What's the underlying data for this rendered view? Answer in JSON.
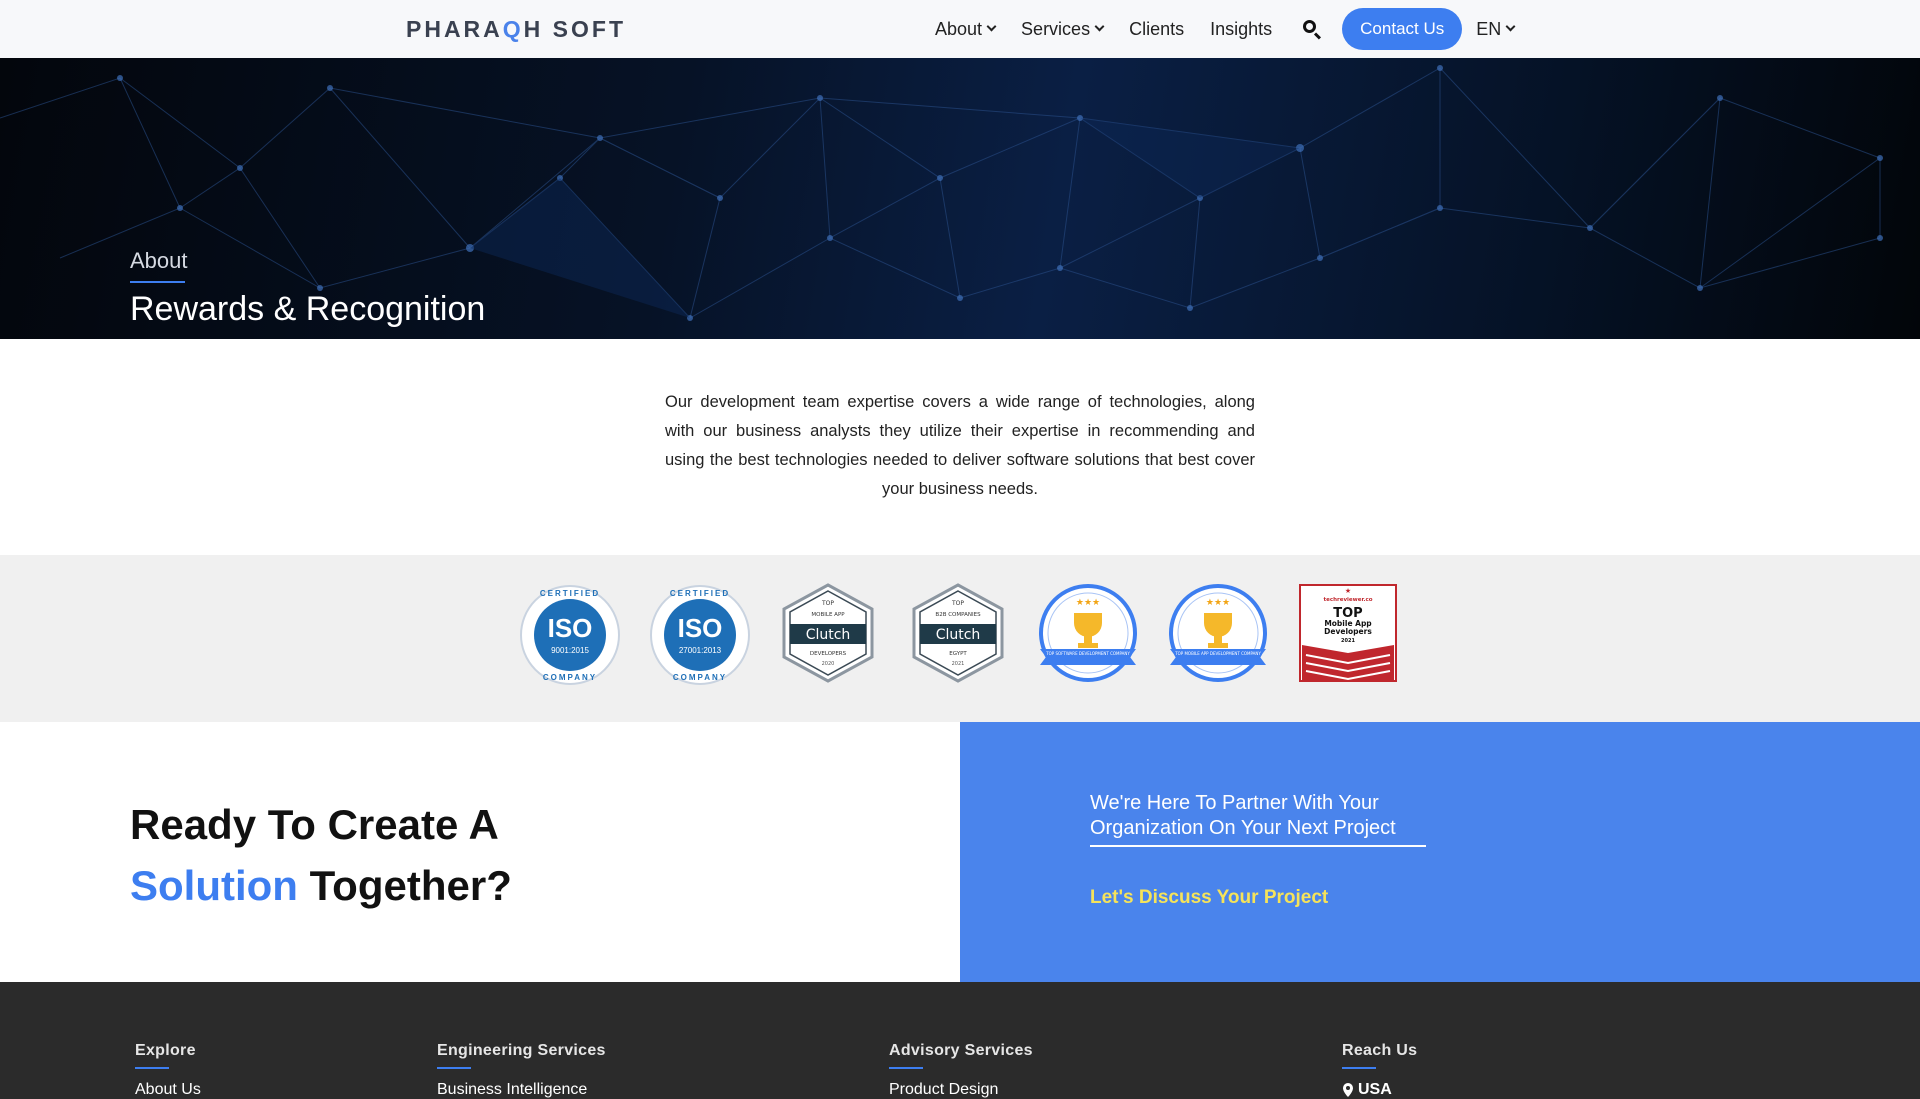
{
  "header": {
    "logo": {
      "part1": "PHARA",
      "part2": "Q",
      "part3": "H SOFT"
    },
    "nav": [
      {
        "label": "About",
        "dropdown": true
      },
      {
        "label": "Services",
        "dropdown": true
      },
      {
        "label": "Clients",
        "dropdown": false
      },
      {
        "label": "Insights",
        "dropdown": false
      }
    ],
    "contact_label": "Contact Us",
    "language": "EN",
    "icons": {
      "search": "search-icon",
      "dropdown": "chevron-down-icon"
    }
  },
  "hero": {
    "subtitle": "About",
    "title": "Rewards & Recognition"
  },
  "intro": {
    "text": "Our development team expertise covers a wide range of technologies, along with our business analysts they utilize their expertise in recommending and using the best technologies needed to deliver software solutions that best cover your business needs."
  },
  "badges": [
    {
      "kind": "iso",
      "top": "CERTIFIED",
      "main": "ISO",
      "code": "9001:2015",
      "bottom": "COMPANY"
    },
    {
      "kind": "iso",
      "top": "CERTIFIED",
      "main": "ISO",
      "code": "27001:2013",
      "bottom": "COMPANY"
    },
    {
      "kind": "clutch",
      "line1": "TOP",
      "line2": "MOBILE APP",
      "brand": "Clutch",
      "line3": "DEVELOPERS",
      "year": "2020"
    },
    {
      "kind": "clutch",
      "line1": "TOP",
      "line2": "B2B COMPANIES",
      "brand": "Clutch",
      "line3": "EGYPT",
      "year": "2021"
    },
    {
      "kind": "goodfirms",
      "caption": "TOP SOFTWARE DEVELOPMENT COMPANY"
    },
    {
      "kind": "goodfirms",
      "caption": "TOP MOBILE APP DEVELOPMENT COMPANY"
    },
    {
      "kind": "techreviewer",
      "site": "techreviewer.co",
      "line1": "TOP",
      "line2": "Mobile App",
      "line3": "Developers",
      "year": "2021"
    }
  ],
  "cta": {
    "heading_line1": "Ready To Create A",
    "heading_highlight": "Solution",
    "heading_rest": " Together?",
    "right_title": "We're Here To Partner With Your Organization On Your Next Project",
    "right_link": "Let's Discuss Your Project"
  },
  "footer": {
    "columns": [
      {
        "heading": "Explore",
        "first_link": "About Us"
      },
      {
        "heading": "Engineering Services",
        "first_link": "Business Intelligence"
      },
      {
        "heading": "Advisory Services",
        "first_link": "Product Design"
      },
      {
        "heading": "Reach Us",
        "first_link": "USA"
      }
    ],
    "icons": {
      "location": "map-pin-icon"
    }
  },
  "colors": {
    "accent": "#3d7ef0",
    "cta_panel": "#4a84ec",
    "cta_link": "#f5e35a",
    "footer_bg": "#2b2b2b",
    "hero_bg": "#061226"
  }
}
